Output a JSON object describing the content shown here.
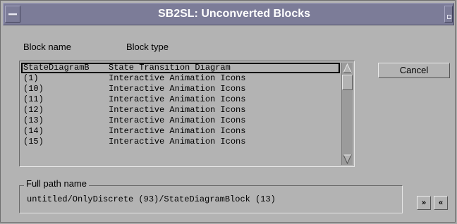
{
  "window": {
    "title": "SB2SL: Unconverted Blocks"
  },
  "headers": {
    "block_name": "Block name",
    "block_type": "Block type"
  },
  "list": {
    "rows": [
      {
        "name": "StateDiagramB",
        "type": "State Transition Diagram",
        "selected": true
      },
      {
        "name": "(1)",
        "type": "Interactive Animation Icons"
      },
      {
        "name": "(10)",
        "type": "Interactive Animation Icons"
      },
      {
        "name": "(11)",
        "type": "Interactive Animation Icons"
      },
      {
        "name": "(12)",
        "type": "Interactive Animation Icons"
      },
      {
        "name": "(13)",
        "type": "Interactive Animation Icons"
      },
      {
        "name": "(14)",
        "type": "Interactive Animation Icons"
      },
      {
        "name": "(15)",
        "type": "Interactive Animation Icons"
      }
    ]
  },
  "buttons": {
    "cancel": "Cancel",
    "next": "»",
    "prev": "«"
  },
  "full_path": {
    "label": "Full path name",
    "value": "untitled/OnlyDiscrete (93)/StateDiagramBlock (13)"
  },
  "icons": {
    "window_menu": "window-menu-icon",
    "maximize": "maximize-icon",
    "scroll_up": "scroll-up-arrow-icon",
    "scroll_down": "scroll-down-arrow-icon"
  },
  "colors": {
    "titlebar": "#7c7c98",
    "window_bg": "#b3b3b3",
    "title_text": "#ffffff"
  }
}
